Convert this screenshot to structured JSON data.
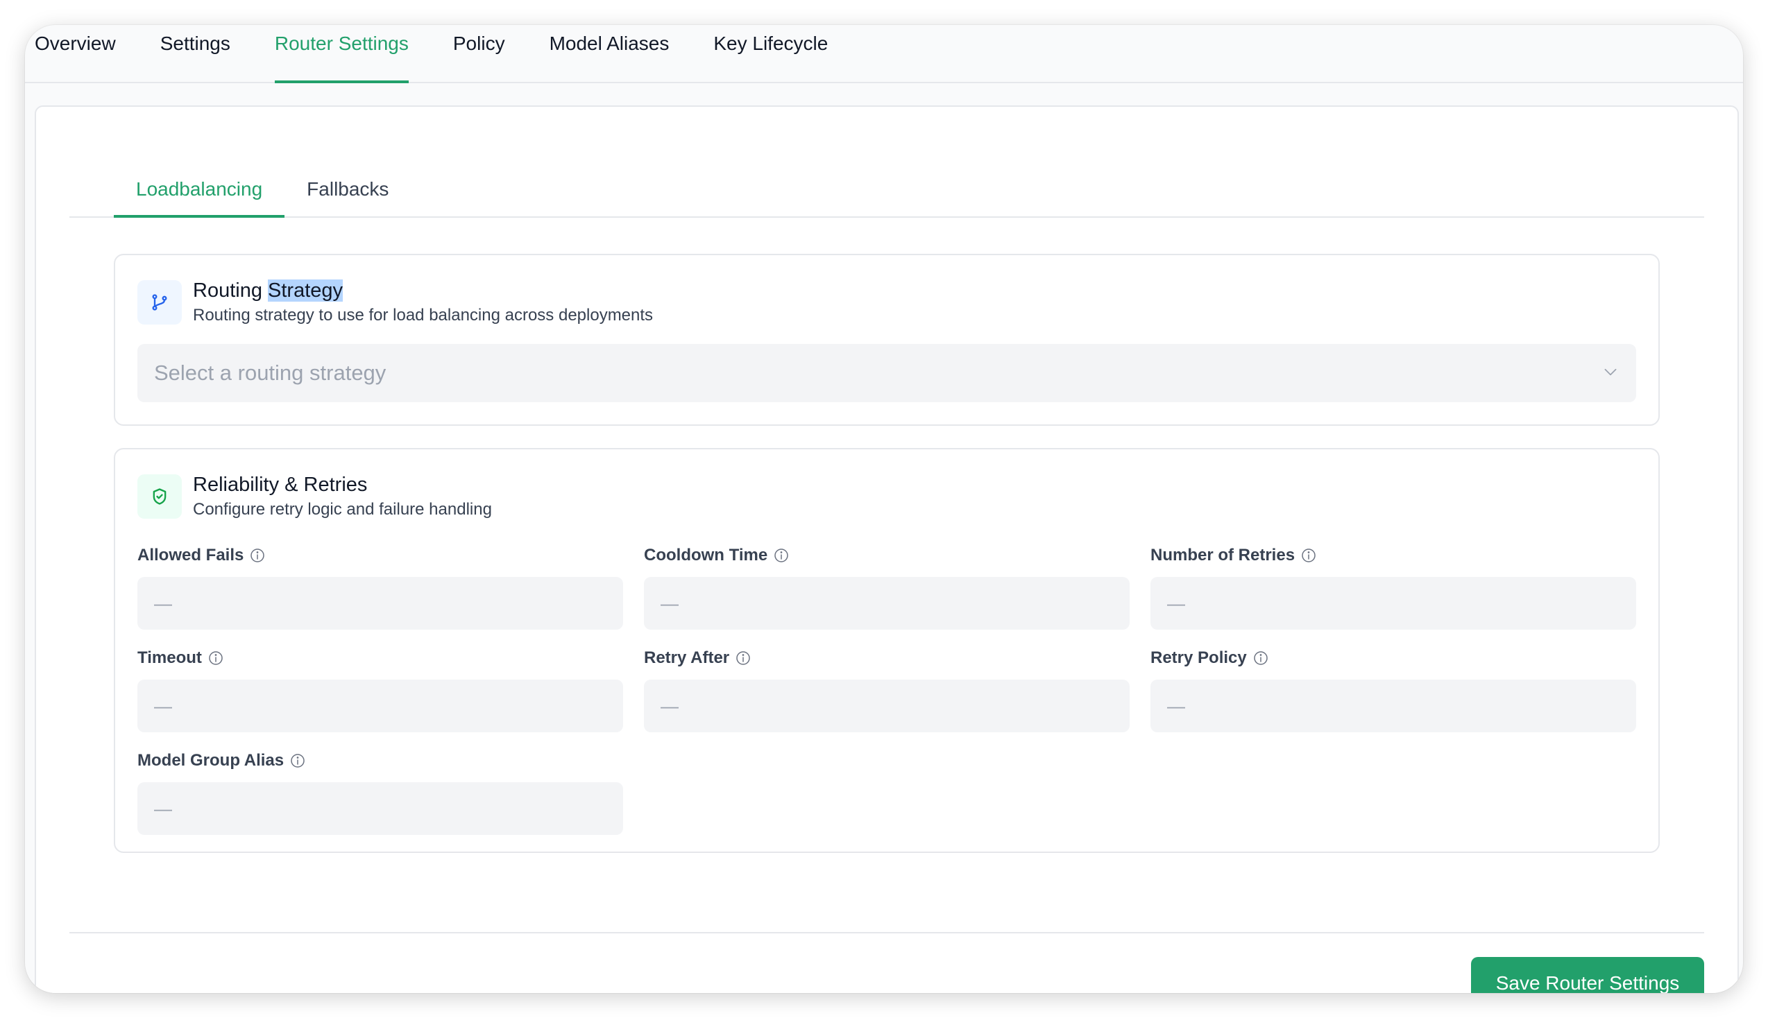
{
  "top_tabs": [
    {
      "label": "Overview",
      "active": false
    },
    {
      "label": "Settings",
      "active": false
    },
    {
      "label": "Router Settings",
      "active": true
    },
    {
      "label": "Policy",
      "active": false
    },
    {
      "label": "Model Aliases",
      "active": false
    },
    {
      "label": "Key Lifecycle",
      "active": false
    }
  ],
  "sub_tabs": [
    {
      "label": "Loadbalancing",
      "active": true
    },
    {
      "label": "Fallbacks",
      "active": false
    }
  ],
  "routing": {
    "title_part1": "Routing ",
    "title_part2": "Strategy",
    "subtitle": "Routing strategy to use for load balancing across deployments",
    "select_placeholder": "Select a routing strategy",
    "icon": "git-branch-icon"
  },
  "reliability": {
    "title": "Reliability & Retries",
    "subtitle": "Configure retry logic and failure handling",
    "icon": "shield-check-icon",
    "fields": [
      {
        "label": "Allowed Fails",
        "value": "—"
      },
      {
        "label": "Cooldown Time",
        "value": "—"
      },
      {
        "label": "Number of Retries",
        "value": "—"
      },
      {
        "label": "Timeout",
        "value": "—"
      },
      {
        "label": "Retry After",
        "value": "—"
      },
      {
        "label": "Retry Policy",
        "value": "—"
      },
      {
        "label": "Model Group Alias",
        "value": "—"
      }
    ]
  },
  "save_button": "Save Router Settings",
  "colors": {
    "accent": "#22a06b",
    "selection": "#b4d5fe",
    "input_bg": "#f3f4f6"
  }
}
